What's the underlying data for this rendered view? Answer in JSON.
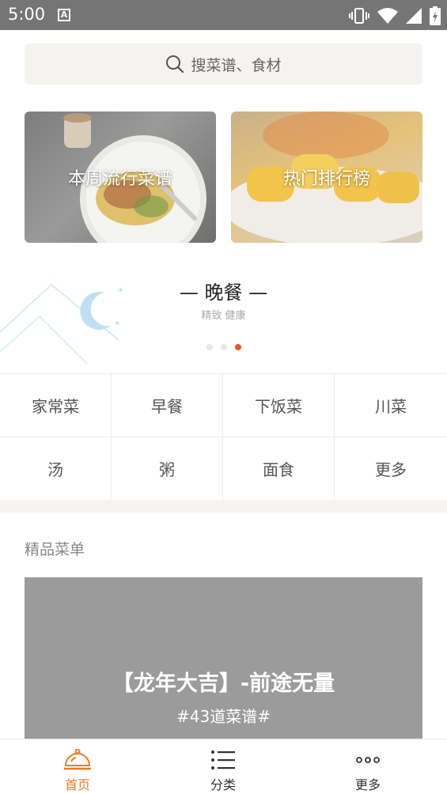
{
  "status_bar": {
    "time": "5:00",
    "notification_letter": "A"
  },
  "search": {
    "placeholder": "搜菜谱、食材"
  },
  "banners": [
    {
      "label": "本周流行菜谱"
    },
    {
      "label": "热门排行榜"
    }
  ],
  "meal": {
    "title": "— 晚餐 —",
    "subtitle": "精致 健康",
    "dot_count": 3,
    "active_dot": 2
  },
  "categories": [
    {
      "label": "家常菜"
    },
    {
      "label": "早餐"
    },
    {
      "label": "下饭菜"
    },
    {
      "label": "川菜"
    },
    {
      "label": "汤"
    },
    {
      "label": "粥"
    },
    {
      "label": "面食"
    },
    {
      "label": "更多"
    }
  ],
  "featured": {
    "section_title": "精品菜单",
    "card_title": "【龙年大吉】-前途无量",
    "card_subtitle": "#43道菜谱#"
  },
  "tabs": [
    {
      "label": "首页",
      "icon": "cloche-icon",
      "active": true
    },
    {
      "label": "分类",
      "icon": "list-icon",
      "active": false
    },
    {
      "label": "更多",
      "icon": "more-dots-icon",
      "active": false
    }
  ],
  "colors": {
    "accent": "#ee7a22",
    "active_dot": "#ee5522",
    "search_bg": "#f4f3ef",
    "status_bar": "#757575"
  }
}
